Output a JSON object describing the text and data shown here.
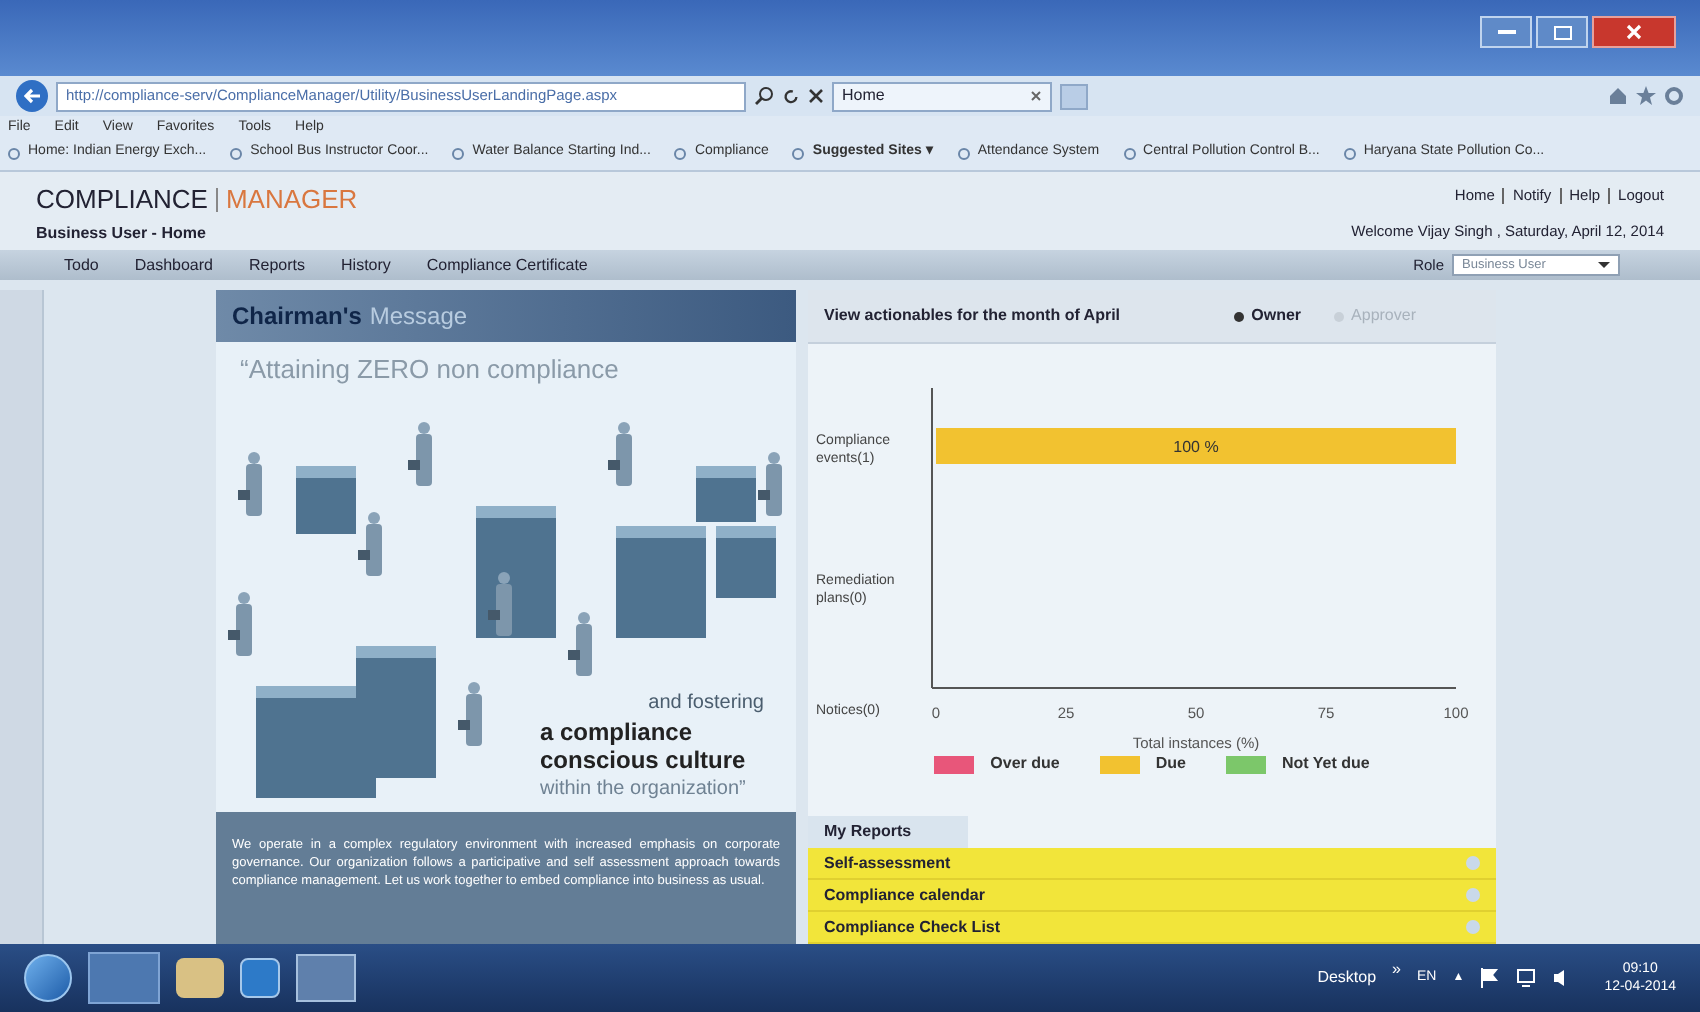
{
  "browser": {
    "address": "http://compliance-serv/ComplianceManager/Utility/BusinessUserLandingPage.aspx",
    "tab": {
      "label": "Home"
    },
    "menu": [
      "File",
      "Edit",
      "View",
      "Favorites",
      "Tools",
      "Help"
    ],
    "favorites": [
      {
        "label": "Home: Indian Energy Exch...",
        "bold": false
      },
      {
        "label": "School Bus Instructor Coor...",
        "bold": false
      },
      {
        "label": "Water Balance Starting Ind...",
        "bold": false
      },
      {
        "label": "Compliance",
        "bold": false
      },
      {
        "label": "Suggested Sites ▾",
        "bold": true
      },
      {
        "label": "Attendance System",
        "bold": false
      },
      {
        "label": "Central Pollution Control B...",
        "bold": false
      },
      {
        "label": "Haryana State Pollution Co...",
        "bold": false
      }
    ]
  },
  "app": {
    "logo": {
      "first": "COMPLIANCE",
      "second": "MANAGER"
    },
    "top_links": [
      "Home",
      "Notify",
      "Help",
      "Logout"
    ],
    "breadcrumb": "Business User - Home",
    "welcome": "Welcome Vijay Singh , Saturday, April 12, 2014",
    "nav": [
      {
        "label": "Todo",
        "selected": false
      },
      {
        "label": "Dashboard",
        "selected": false
      },
      {
        "label": "Reports",
        "selected": false
      },
      {
        "label": "History",
        "selected": false
      },
      {
        "label": "Compliance Certificate",
        "selected": false
      }
    ],
    "role": {
      "label": "Role",
      "value": "Business User"
    },
    "chairman": {
      "title_bold": "Chairman's",
      "title_light": "Message",
      "banner": {
        "line1": "“Attaining  ZERO non compliance",
        "line2": "and fostering",
        "line3": "a compliance conscious culture",
        "line4": "within the organization”"
      },
      "text": "We operate in a complex regulatory environment with increased emphasis on corporate governance. Our organization follows a participative and self assessment approach towards compliance management. Let us work together to embed compliance into business as usual."
    },
    "actionables": {
      "label": "View actionables for the month of  April",
      "options": [
        {
          "label": "Owner",
          "selected": true
        },
        {
          "label": "Approver",
          "selected": false
        }
      ],
      "chart_data": {
        "type": "bar",
        "orientation": "horizontal",
        "stacked": true,
        "xlabel": "Total instances (%)",
        "categories": [
          "Compliance events(1)",
          "Remediation plans(0)",
          "Notices(0)"
        ],
        "xlim": [
          0,
          100
        ],
        "xticks": [
          0,
          25,
          50,
          75,
          100
        ],
        "series": [
          {
            "name": "Over due",
            "color": "#e8567a",
            "values": [
              0,
              0,
              0
            ]
          },
          {
            "name": "Due",
            "color": "#f2c230",
            "values": [
              100,
              0,
              0
            ]
          },
          {
            "name": "Not Yet due",
            "color": "#7cc76a",
            "values": [
              0,
              0,
              0
            ]
          }
        ],
        "value_labels": [
          "100 %"
        ]
      }
    },
    "reports": {
      "title": "My Reports",
      "items": [
        "Self-assessment",
        "Compliance calendar",
        "Compliance Check List"
      ]
    }
  },
  "taskbar": {
    "desktop": "Desktop",
    "chevron": "»",
    "lang": "EN",
    "tray_arrow": "▲",
    "time": "09:10",
    "date": "12-04-2014"
  }
}
